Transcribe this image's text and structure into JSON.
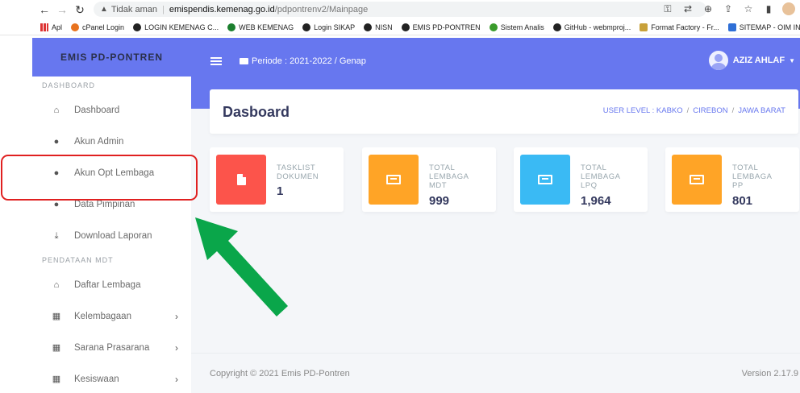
{
  "browser": {
    "not_secure": "Tidak aman",
    "url_host": "emispendis.kemenag.go.id",
    "url_path": "/pdpontrenv2/Mainpage",
    "bookmarks": [
      "Apl",
      "cPanel Login",
      "LOGIN KEMENAG C...",
      "WEB KEMENAG",
      "Login SIKAP",
      "NISN",
      "EMIS PD-PONTREN",
      "Sistem Analis",
      "GitHub - webmproj...",
      "Format Factory - Fr...",
      "SITEMAP - OIM INFO"
    ]
  },
  "sidebar": {
    "brand": "EMIS PD-PONTREN",
    "section_dashboard": "DASHBOARD",
    "section_pendataan": "PENDATAAN MDT",
    "items": [
      {
        "label": "Dashboard",
        "icon": "home-icon"
      },
      {
        "label": "Akun Admin",
        "icon": "user-tie-icon"
      },
      {
        "label": "Akun Opt Lembaga",
        "icon": "user-icon"
      },
      {
        "label": "Data Pimpinan",
        "icon": "user-icon"
      },
      {
        "label": "Download Laporan",
        "icon": "download-icon"
      },
      {
        "label": "Daftar Lembaga",
        "icon": "landmark-icon"
      },
      {
        "label": "Kelembagaan",
        "icon": "table-icon"
      },
      {
        "label": "Sarana Prasarana",
        "icon": "table-icon"
      },
      {
        "label": "Kesiswaan",
        "icon": "table-icon"
      }
    ]
  },
  "header": {
    "periode": "Periode : 2021-2022 / Genap",
    "user_name": "AZIZ AHLAF"
  },
  "page": {
    "title": "Dasboard",
    "breadcrumb": [
      "USER LEVEL : KABKO",
      "CIREBON",
      "JAWA BARAT"
    ]
  },
  "stats": [
    {
      "label_line1": "TASKLIST",
      "label_line2": "DOKUMEN",
      "label_line3": "",
      "value": "1",
      "color": "#fc544b",
      "icon": "file-icon"
    },
    {
      "label_line1": "TOTAL",
      "label_line2": "LEMBAGA",
      "label_line3": "MDT",
      "value": "999",
      "color": "#ffa426",
      "icon": "newspaper-icon"
    },
    {
      "label_line1": "TOTAL",
      "label_line2": "LEMBAGA",
      "label_line3": "LPQ",
      "value": "1,964",
      "color": "#3abaf4",
      "icon": "newspaper-icon"
    },
    {
      "label_line1": "TOTAL",
      "label_line2": "LEMBAGA",
      "label_line3": "PP",
      "value": "801",
      "color": "#ffa426",
      "icon": "newspaper-icon"
    }
  ],
  "footer": {
    "copyright": "Copyright © 2021 Emis PD-Pontren",
    "version": "Version 2.17.9"
  },
  "colors": {
    "primary": "#6777ef",
    "highlight": "#e02020",
    "arrow": "#0aa64a"
  }
}
